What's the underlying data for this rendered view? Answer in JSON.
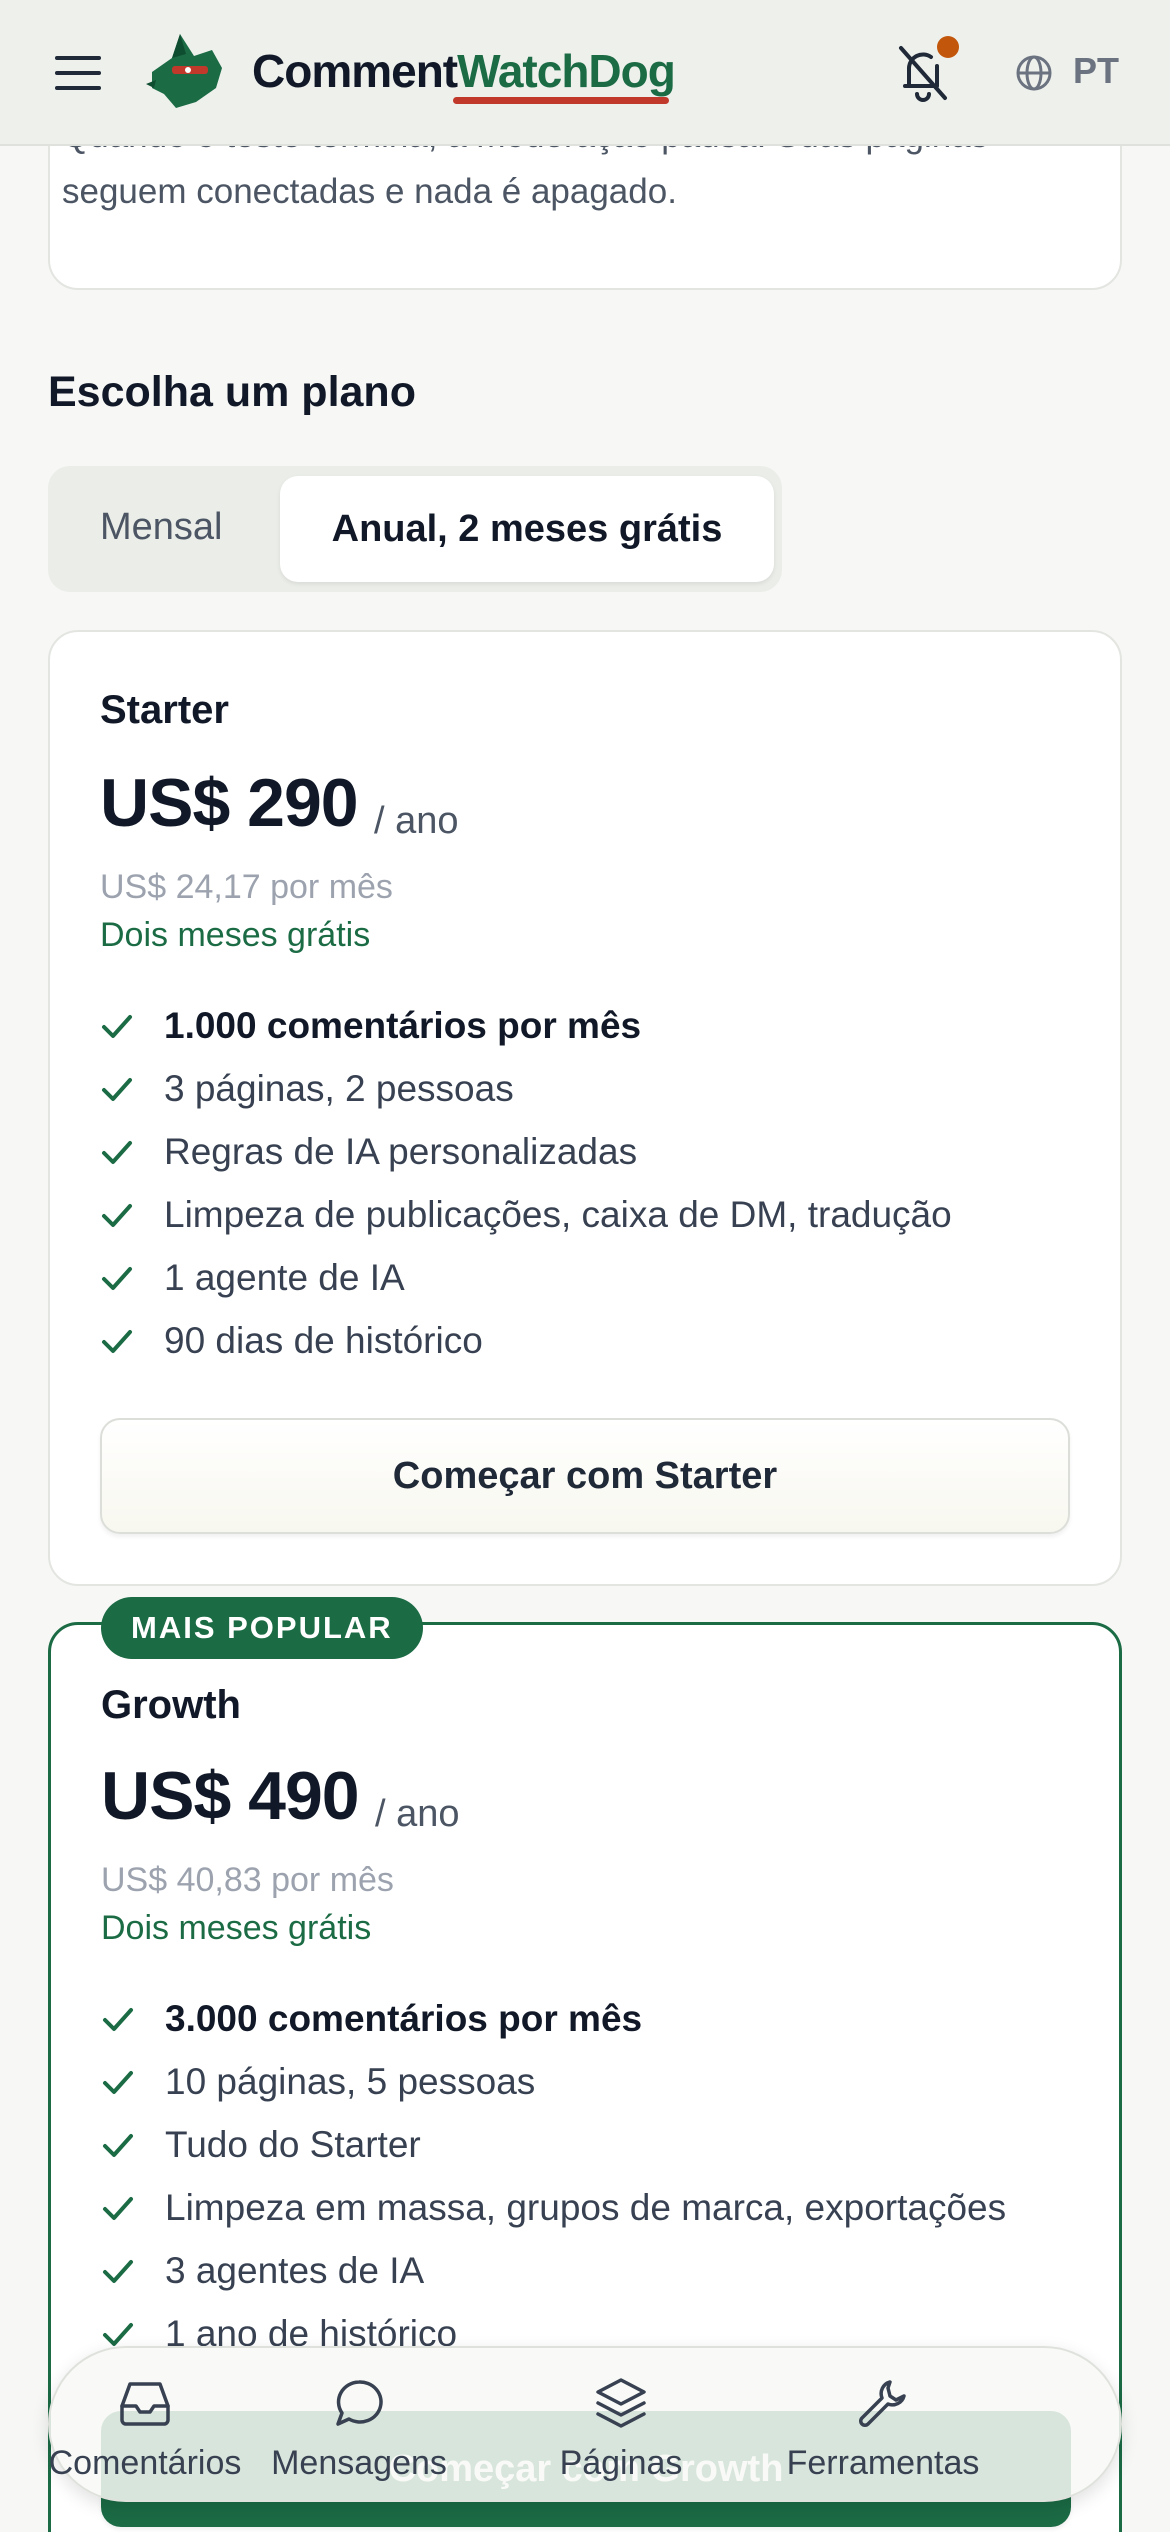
{
  "header": {
    "brand_part1": "Comment",
    "brand_part2": "WatchDog",
    "language": "PT",
    "icons": [
      "menu-icon",
      "dog-logo-icon",
      "bell-off-icon",
      "globe-icon"
    ]
  },
  "top_card": {
    "text": "Quando o teste termina, a moderação pausa. Suas páginas seguem conectadas e nada é apagado."
  },
  "section_title": "Escolha um plano",
  "billing_toggle": {
    "monthly": "Mensal",
    "annual": "Anual, 2 meses grátis",
    "selected": "annual"
  },
  "plans": [
    {
      "name": "Starter",
      "price": "US$ 290",
      "unit": "/ ano",
      "monthly_equivalent": "US$ 24,17 por mês",
      "promo": "Dois meses grátis",
      "features": [
        "1.000 comentários por mês",
        "3 páginas, 2 pessoas",
        "Regras de IA personalizadas",
        "Limpeza de publicações, caixa de DM, tradução",
        "1 agente de IA",
        "90 dias de histórico"
      ],
      "cta": "Começar com Starter"
    },
    {
      "badge": "MAIS POPULAR",
      "name": "Growth",
      "price": "US$ 490",
      "unit": "/ ano",
      "monthly_equivalent": "US$ 40,83 por mês",
      "promo": "Dois meses grátis",
      "features": [
        "3.000 comentários por mês",
        "10 páginas, 5 pessoas",
        "Tudo do Starter",
        "Limpeza em massa, grupos de marca, exportações",
        "3 agentes de IA",
        "1 ano de histórico"
      ],
      "cta": "Começar com Growth"
    }
  ],
  "bottom_nav": [
    {
      "label": "Comentários",
      "icon": "inbox-icon"
    },
    {
      "label": "Mensagens",
      "icon": "chat-bubble-icon"
    },
    {
      "label": "Páginas",
      "icon": "layers-icon"
    },
    {
      "label": "Ferramentas",
      "icon": "wrench-icon"
    }
  ],
  "colors": {
    "brand_green": "#1b6b45",
    "brand_red": "#c0392b",
    "notification_dot": "#c2570c"
  }
}
